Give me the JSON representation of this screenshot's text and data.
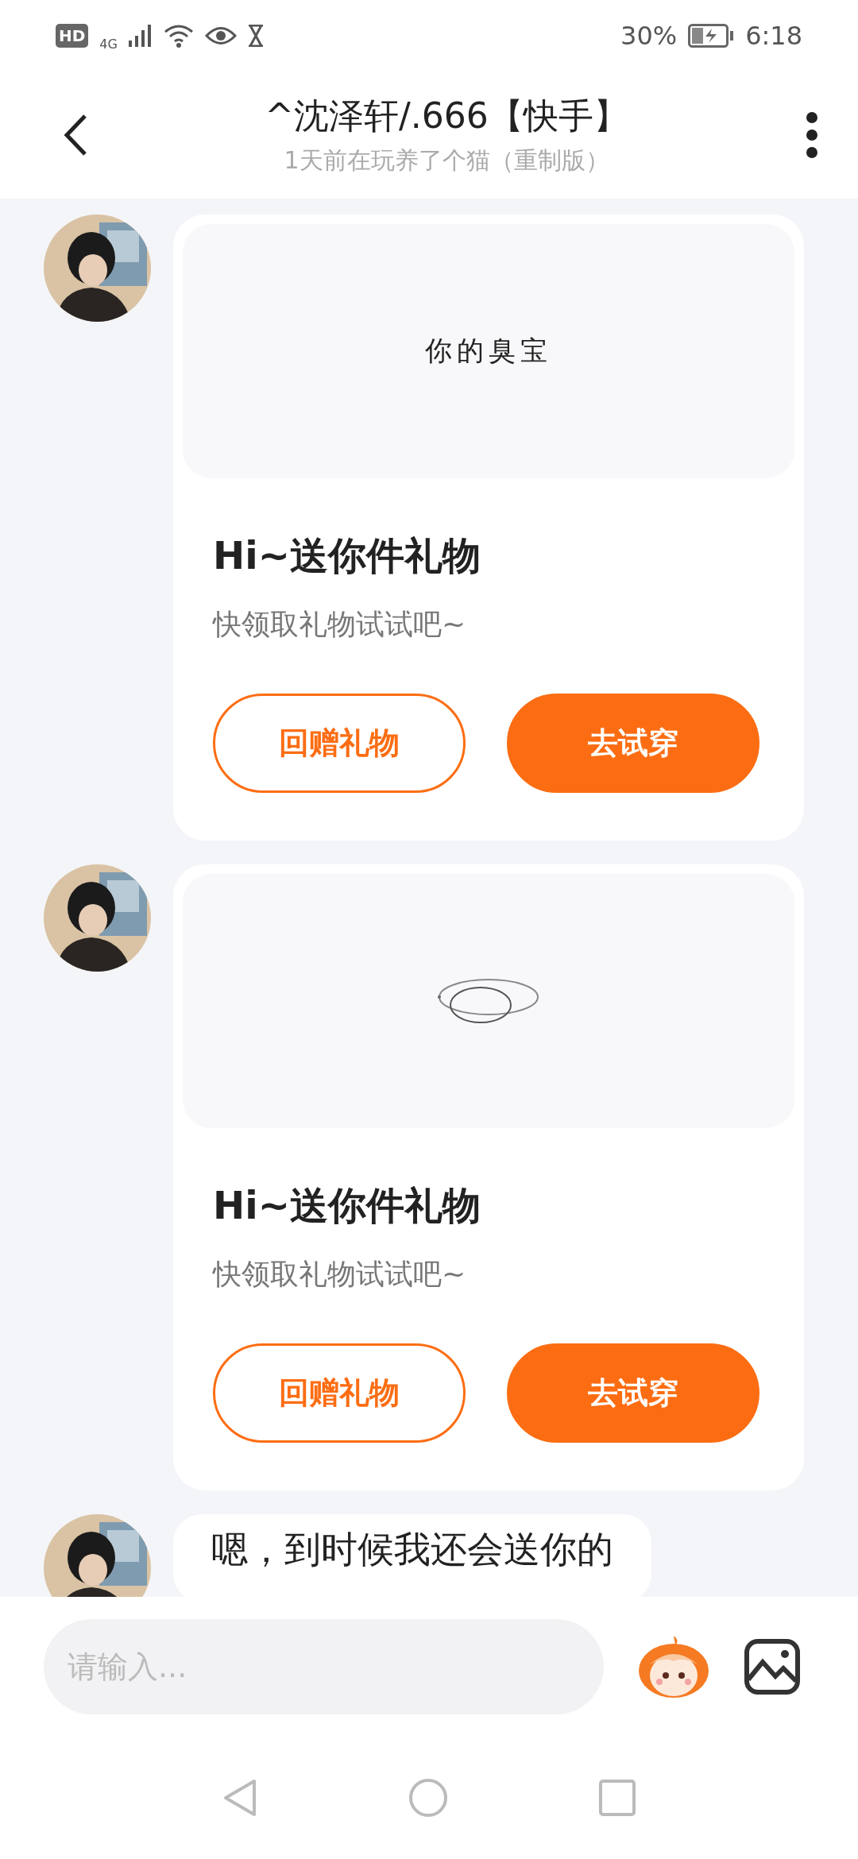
{
  "status_bar": {
    "hd": "HD",
    "network": "4G",
    "battery": "30%",
    "time": "6:18"
  },
  "header": {
    "title": "^沈泽轩/.666【快手】",
    "subtitle": "1天前在玩养了个猫（重制版）"
  },
  "messages": [
    {
      "kind": "gift",
      "preview": {
        "kind": "text",
        "text": "你的臭宝"
      },
      "title": "Hi~送你件礼物",
      "subtitle": "快领取礼物试试吧~",
      "buttons": [
        {
          "label": "回赠礼物",
          "kind": "outline"
        },
        {
          "label": "去试穿",
          "kind": "filled"
        }
      ]
    },
    {
      "kind": "gift",
      "preview": {
        "kind": "rings"
      },
      "title": "Hi~送你件礼物",
      "subtitle": "快领取礼物试试吧~",
      "buttons": [
        {
          "label": "回赠礼物",
          "kind": "outline"
        },
        {
          "label": "去试穿",
          "kind": "filled"
        }
      ]
    },
    {
      "kind": "text",
      "text": "嗯，到时候我还会送你的"
    }
  ],
  "composer": {
    "placeholder": "请输入..."
  }
}
